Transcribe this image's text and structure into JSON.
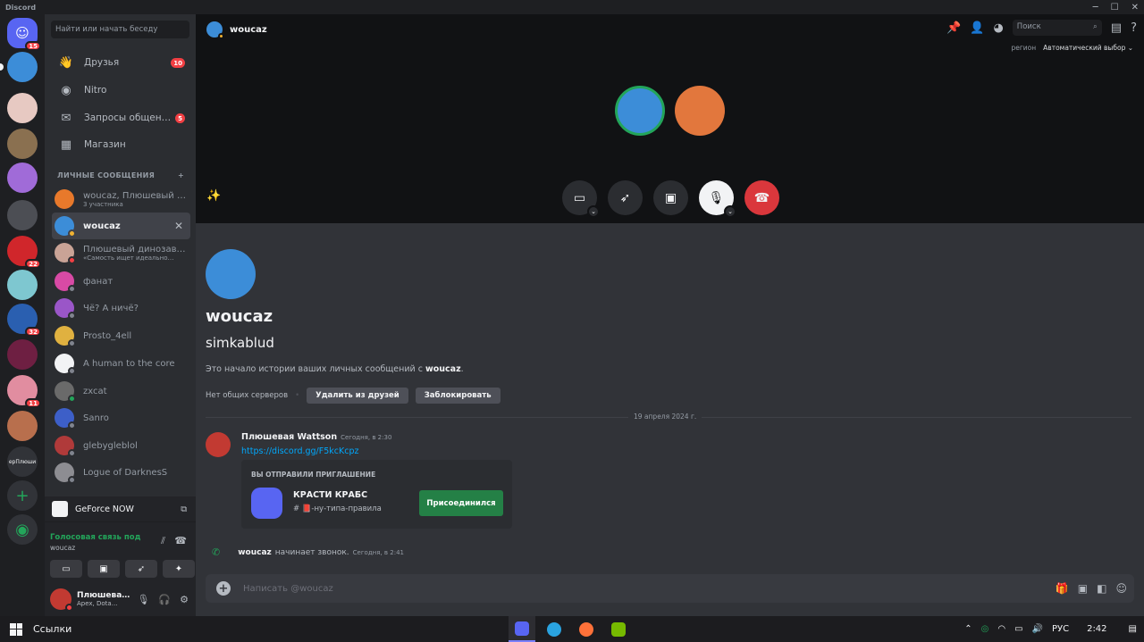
{
  "app": {
    "title": "Discord",
    "window_controls": [
      "─",
      "☐",
      "✕"
    ]
  },
  "colors": {
    "accent": "#5865f2",
    "green": "#23a55a",
    "red": "#f23f43",
    "link": "#00a8fc"
  },
  "guilds": [
    {
      "name": "home",
      "badge": "15",
      "color": "#5865f2"
    },
    {
      "name": "woucaz",
      "badge": "",
      "color": "#3c8dd8"
    },
    {
      "name": "server-pink",
      "badge": "",
      "color": "#e7c9c2"
    },
    {
      "name": "server-dog",
      "badge": "",
      "color": "#8a7050"
    },
    {
      "name": "server-krabs",
      "badge": "",
      "color": "#a06bd8"
    },
    {
      "name": "server-grey",
      "badge": "",
      "color": "#4c4e54"
    },
    {
      "name": "server-red",
      "badge": "22",
      "color": "#d0262b"
    },
    {
      "name": "server-anime",
      "badge": "",
      "color": "#7ec7d0"
    },
    {
      "name": "server-tbr",
      "badge": "32",
      "color": "#2a5fb0"
    },
    {
      "name": "server-dark",
      "badge": "",
      "color": "#6e1f42"
    },
    {
      "name": "server-girl",
      "badge": "11",
      "color": "#e18da0"
    },
    {
      "name": "server-boy",
      "badge": "",
      "color": "#b86f4d"
    },
    {
      "name": "server-text",
      "badge": "",
      "color": "#313338",
      "label": "epПлюши"
    }
  ],
  "sidebar": {
    "search_placeholder": "Найти или начать беседу",
    "nav": [
      {
        "label": "Друзья",
        "badge": "10",
        "icon": "👋"
      },
      {
        "label": "Nitro",
        "badge": "",
        "icon": "◉"
      },
      {
        "label": "Запросы общен…",
        "badge": "5",
        "icon": "✉"
      },
      {
        "label": "Магазин",
        "badge": "",
        "icon": "▦"
      }
    ],
    "dm_header": "ЛИЧНЫЕ СООБЩЕНИЯ",
    "dm_add": "+",
    "dms": [
      {
        "name": "woucaz, Плюшевый …",
        "sub": "3 участника",
        "color": "#e8792b",
        "status": ""
      },
      {
        "name": "woucaz",
        "sub": "",
        "color": "#3c8dd8",
        "status": "#f0b232",
        "active": true
      },
      {
        "name": "Плюшевый динозав…",
        "sub": "«Самость ищет идеально…",
        "color": "#c9a396",
        "status": "#f23f43"
      },
      {
        "name": "фанат",
        "sub": "",
        "color": "#d84aa5",
        "status": "#80848e"
      },
      {
        "name": "Чё? А ничё?",
        "sub": "",
        "color": "#9a56c8",
        "status": "#80848e"
      },
      {
        "name": "Prosto_4ell",
        "sub": "",
        "color": "#e0b140",
        "status": "#80848e"
      },
      {
        "name": "A human to the core",
        "sub": "",
        "color": "#f2f3f5",
        "status": "#80848e"
      },
      {
        "name": "zxcat",
        "sub": "",
        "color": "#6a6a6a",
        "status": "#23a55a"
      },
      {
        "name": "Sanro",
        "sub": "",
        "color": "#3d5fc8",
        "status": "#80848e"
      },
      {
        "name": "glebygleblol",
        "sub": "",
        "color": "#b03a3a",
        "status": "#80848e"
      },
      {
        "name": "Logue of DarknesS",
        "sub": "",
        "color": "#8d8d92",
        "status": "#80848e"
      }
    ],
    "game": "GeForce NOW",
    "voice": {
      "title": "Голосовая связь под",
      "sub": "woucaz"
    },
    "user": {
      "name": "Плюшева…",
      "status": "Apex, Dota…"
    }
  },
  "call": {
    "header_name": "woucaz",
    "search_placeholder": "Поиск",
    "region_label": "регион",
    "region_value": "Автоматический выбор ⌄"
  },
  "profile": {
    "name": "woucaz",
    "tag": "simkablud",
    "desc_prefix": "Это начало истории ваших личных сообщений с ",
    "desc_name": "woucaz",
    "desc_suffix": ".",
    "no_servers": "Нет общих серверов",
    "remove_friend": "Удалить из друзей",
    "block": "Заблокировать"
  },
  "divider_date": "19 апреля 2024 г.",
  "message": {
    "author": "Плюшевая Wattson",
    "time": "Сегодня, в 2:30",
    "link": "https://discord.gg/F5kcKcpz",
    "invite_header": "ВЫ ОТПРАВИЛИ ПРИГЛАШЕНИЕ",
    "invite_name": "КРАСТИ КРАБС",
    "invite_channel": "📕-ну-типа-правила",
    "join_label": "Присоединился"
  },
  "call_event": {
    "author": "woucaz",
    "text": "начинает звонок.",
    "time": "Сегодня, в 2:41"
  },
  "composer": {
    "placeholder": "Написать @woucaz"
  },
  "taskbar": {
    "search": "Ссылки",
    "lang": "РУС",
    "time": "2:42"
  }
}
